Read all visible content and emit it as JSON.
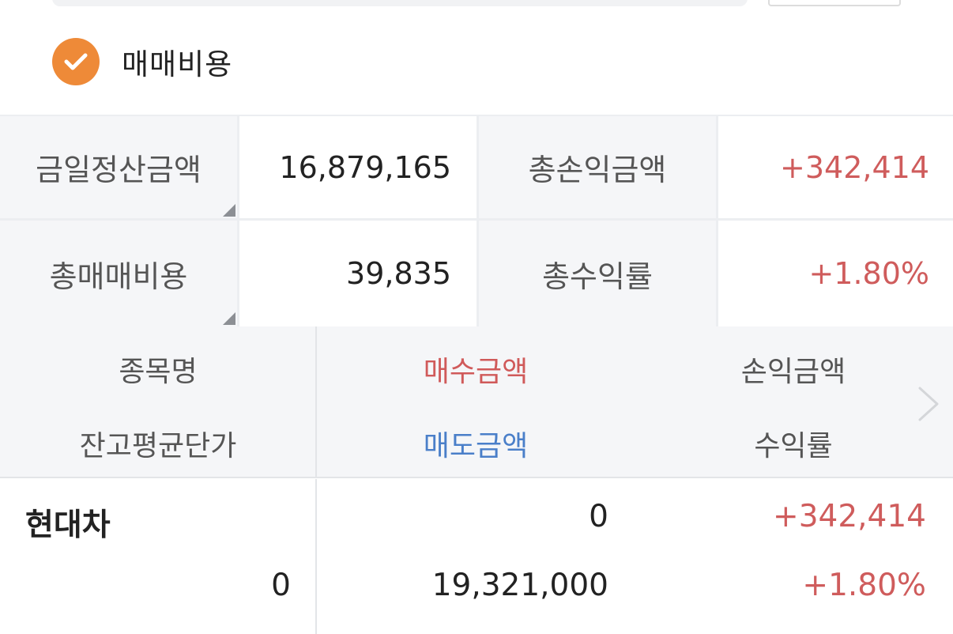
{
  "option": {
    "label": "매매비용",
    "checked": true,
    "accent": "#ee8a38"
  },
  "summary": {
    "settlement_label": "금일정산금액",
    "settlement_value": "16,879,165",
    "total_pl_label": "총손익금액",
    "total_pl_value": "+342,414",
    "total_cost_label": "총매매비용",
    "total_cost_value": "39,835",
    "total_return_label": "총수익률",
    "total_return_value": "+1.80%"
  },
  "table": {
    "headers": {
      "name": "종목명",
      "buy_amount": "매수금액",
      "pl_amount": "손익금액",
      "avg_price": "잔고평균단가",
      "sell_amount": "매도금액",
      "return_rate": "수익률"
    },
    "rows": [
      {
        "name": "현대차",
        "avg_price": "0",
        "buy_amount": "0",
        "sell_amount": "19,321,000",
        "pl_amount": "+342,414",
        "return_rate": "+1.80%"
      }
    ]
  },
  "colors": {
    "profit": "#cf5c5c",
    "buy": "#d05a5a",
    "sell": "#4a7fc9"
  },
  "icons": {
    "check": "check-icon",
    "next": "chevron-right-icon",
    "corner": "corner-triangle-icon"
  }
}
